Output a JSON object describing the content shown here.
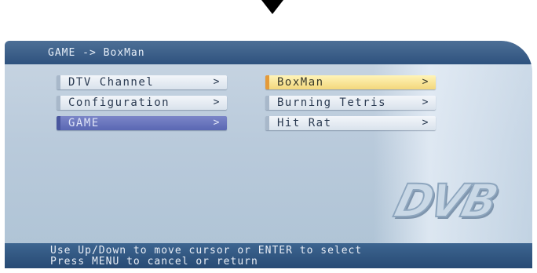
{
  "header": {
    "title": "GAME -> BoxMan"
  },
  "main_menu": [
    {
      "label": "DTV Channel",
      "chevron": ">"
    },
    {
      "label": "Configuration",
      "chevron": ">"
    },
    {
      "label": "GAME",
      "chevron": ">"
    }
  ],
  "game_menu": [
    {
      "label": "BoxMan",
      "chevron": ">"
    },
    {
      "label": "Burning Tetris",
      "chevron": ">"
    },
    {
      "label": "Hit Rat",
      "chevron": ">"
    }
  ],
  "logo": {
    "text": "DVB"
  },
  "help": {
    "line1": "Use Up/Down to move cursor or ENTER to select",
    "line2": "Press MENU to cancel or return"
  },
  "colors": {
    "title_bar": "#2e527e",
    "selected_item": "#5a67b3",
    "highlight_item": "#f3d77c",
    "help_bar": "#274a74"
  }
}
